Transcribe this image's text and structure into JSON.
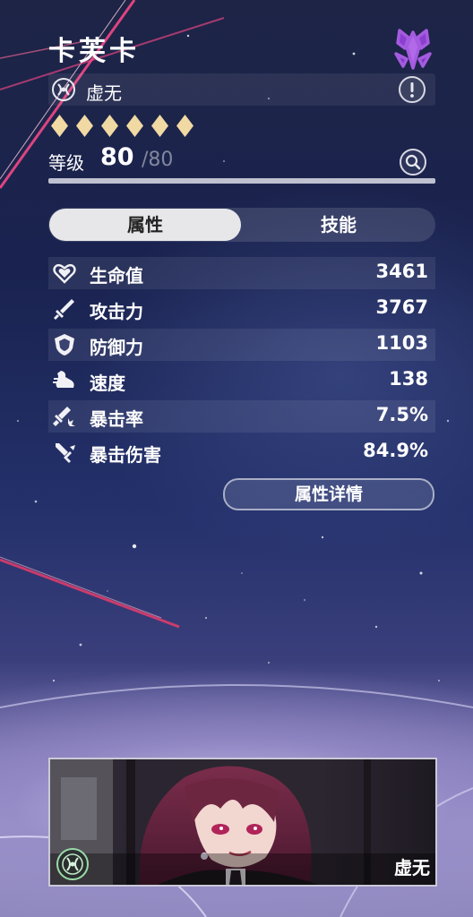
{
  "character": {
    "name": "卡芙卡",
    "path": "虚无",
    "rarity": 5
  },
  "level": {
    "label": "等级",
    "current": "80",
    "max": "/80",
    "progress": 1.0
  },
  "tabs": {
    "attributes": "属性",
    "skills": "技能",
    "active": "attributes"
  },
  "stats": [
    {
      "name": "生命值",
      "value": "3461",
      "icon": "heart-icon"
    },
    {
      "name": "攻击力",
      "value": "3767",
      "icon": "sword-icon"
    },
    {
      "name": "防御力",
      "value": "1103",
      "icon": "shield-icon"
    },
    {
      "name": "速度",
      "value": "138",
      "icon": "boot-icon"
    },
    {
      "name": "暴击率",
      "value": "7.5%",
      "icon": "crit-rate-icon"
    },
    {
      "name": "暴击伤害",
      "value": "84.9%",
      "icon": "crit-damage-icon"
    }
  ],
  "detail_button": "属性详情",
  "card": {
    "path_label": "虚无"
  },
  "colors": {
    "star": "#f0d9a3",
    "path_purple": "#a55be0",
    "tab_active_bg": "#e7e7ea"
  }
}
